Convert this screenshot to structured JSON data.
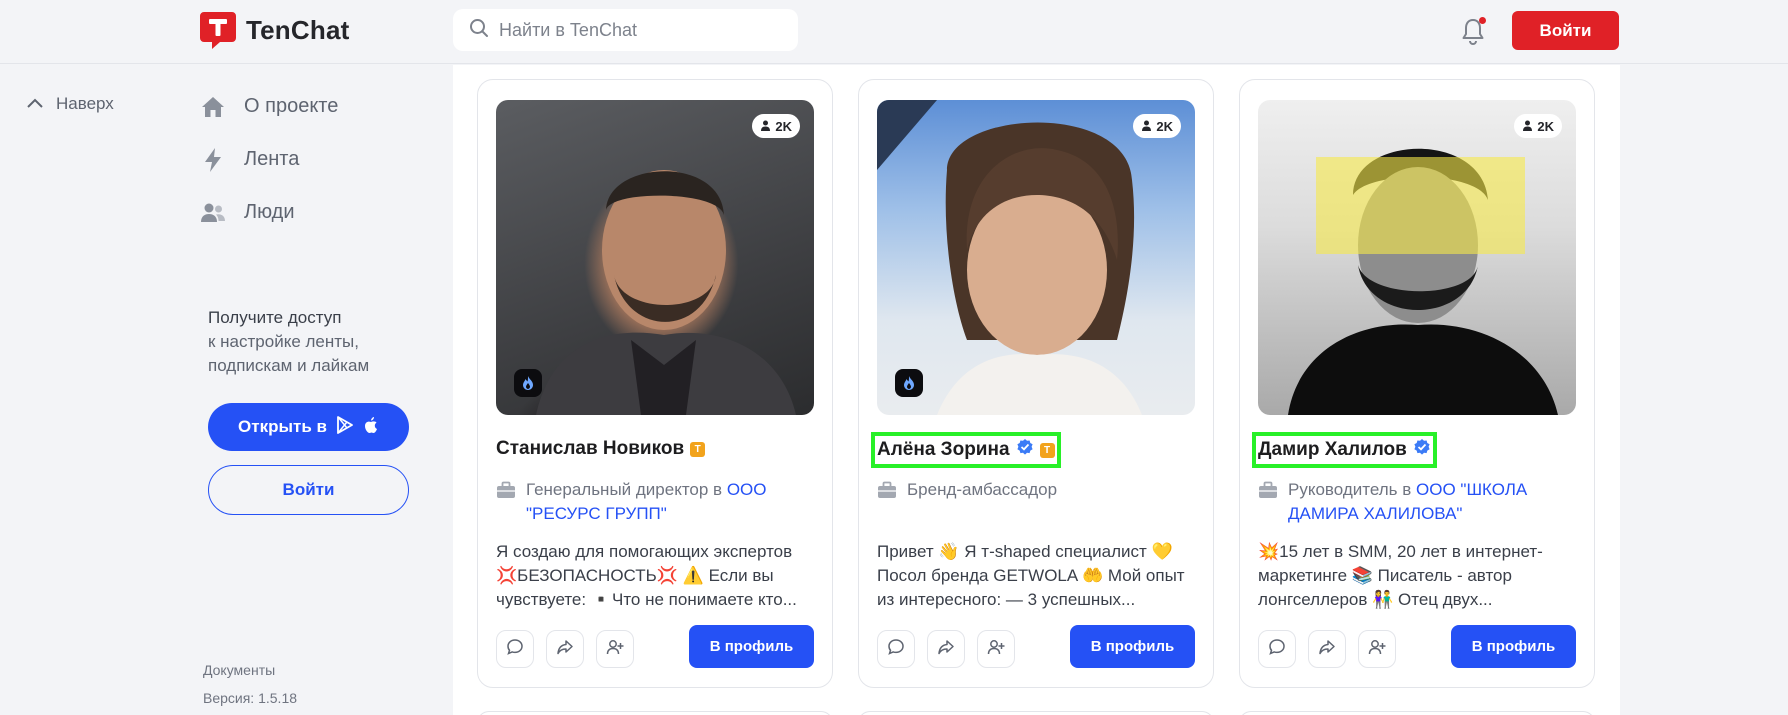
{
  "header": {
    "logo_text": "TenChat",
    "search_placeholder": "Найти в TenChat",
    "login_label": "Войти",
    "brand_color": "#e02127"
  },
  "sidebar": {
    "up_label": "Наверх",
    "nav": [
      {
        "label": "О проекте",
        "icon": "home-icon"
      },
      {
        "label": "Лента",
        "icon": "lightning-icon"
      },
      {
        "label": "Люди",
        "icon": "people-icon"
      }
    ],
    "promo_title": "Получите доступ",
    "promo_line2": "к настройке ленты,",
    "promo_line3": "подпискам и лайкам",
    "open_app_label": "Открыть в",
    "login_label": "Войти",
    "docs_label": "Документы",
    "version_label": "Версия: 1.5.18"
  },
  "cards": [
    {
      "followers": "2K",
      "name": "Станислав Новиков",
      "verified": false,
      "role": "Генеральный директор в",
      "company": "ООО \"РЕСУРС ГРУПП\"",
      "bio": "Я создаю для помогающих экспертов 💢БЕЗОПАСНОСТЬ💢 ⚠️ Если вы чувствуете: ▪️Что не понимаете кто...",
      "profile_label": "В профиль"
    },
    {
      "followers": "2K",
      "name": "Алёна Зорина",
      "verified": true,
      "role": "Бренд-амбассадор",
      "company": "",
      "bio": "Привет 👋 Я т-shaped специалист 💛 Посол бренда GETWOLA 🤲 Мой опыт из интересного: — 3 успешных...",
      "profile_label": "В профиль"
    },
    {
      "followers": "2K",
      "name": "Дамир Халилов",
      "verified": true,
      "role": "Руководитель в",
      "company": "ООО \"ШКОЛА ДАМИРА ХАЛИЛОВА\"",
      "bio": "💥15 лет в SMM, 20 лет в интернет-маркетинге 📚 Писатель - автор лонгселлеров 👫 Отец двух...",
      "profile_label": "В профиль"
    }
  ],
  "colors": {
    "accent": "#2551f5",
    "highlight": "#28f028",
    "tenchat_badge": "#f2a31c"
  }
}
